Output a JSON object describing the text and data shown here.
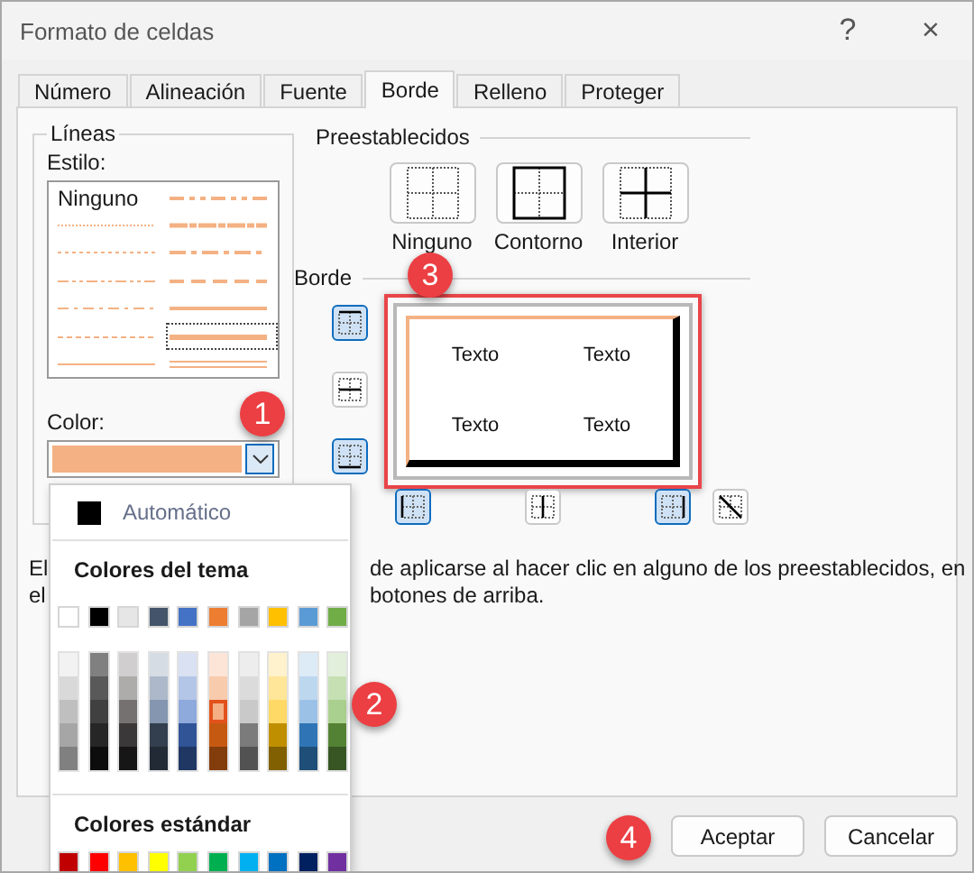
{
  "window": {
    "title": "Formato de celdas",
    "help": "?",
    "close": "×"
  },
  "tabs": [
    {
      "label": "Número",
      "selected": false
    },
    {
      "label": "Alineación",
      "selected": false
    },
    {
      "label": "Fuente",
      "selected": false
    },
    {
      "label": "Borde",
      "selected": true
    },
    {
      "label": "Relleno",
      "selected": false
    },
    {
      "label": "Proteger",
      "selected": false
    }
  ],
  "lines": {
    "title": "Líneas",
    "style_label": "Estilo:",
    "styles": [
      {
        "kind": "none",
        "label": "Ninguno",
        "selected": false
      },
      {
        "kind": "hair",
        "selected": false
      },
      {
        "kind": "dotted",
        "selected": false
      },
      {
        "kind": "dashdotdot",
        "selected": false
      },
      {
        "kind": "dashdot",
        "selected": false
      },
      {
        "kind": "dashed",
        "selected": false
      },
      {
        "kind": "thin",
        "selected": false
      },
      {
        "kind": "medium-dashdotdot",
        "selected": false
      },
      {
        "kind": "slanted-dashdot",
        "selected": false
      },
      {
        "kind": "medium-dashdot",
        "selected": false
      },
      {
        "kind": "medium-dashed",
        "selected": false
      },
      {
        "kind": "medium",
        "selected": false
      },
      {
        "kind": "thick",
        "selected": true
      },
      {
        "kind": "double",
        "selected": false
      }
    ],
    "color_label": "Color:",
    "color": "#f4b183"
  },
  "presets": {
    "title": "Preestablecidos",
    "items": [
      {
        "kind": "none",
        "label": "Ninguno"
      },
      {
        "kind": "outline",
        "label": "Contorno"
      },
      {
        "kind": "inside",
        "label": "Interior"
      }
    ]
  },
  "border": {
    "title": "Borde",
    "side_buttons": [
      {
        "kind": "top",
        "selected": true
      },
      {
        "kind": "middle-h",
        "selected": false
      },
      {
        "kind": "bottom",
        "selected": true
      }
    ],
    "bottom_buttons": [
      {
        "kind": "left",
        "selected": true
      },
      {
        "kind": "middle-v",
        "selected": false
      },
      {
        "kind": "right",
        "selected": true
      },
      {
        "kind": "diagonal",
        "selected": false
      }
    ],
    "preview": {
      "cells": [
        "Texto",
        "Texto",
        "Texto",
        "Texto"
      ],
      "borders": {
        "top": {
          "kind": "thin",
          "color": "#f4b183"
        },
        "left": {
          "kind": "thin",
          "color": "#f4b183"
        },
        "right": {
          "kind": "thick",
          "color": "#000000"
        },
        "bottom": {
          "kind": "thick",
          "color": "#000000"
        }
      }
    }
  },
  "description": [
    {
      "left": "El",
      "right": "de aplicarse al hacer clic en alguno de los preestablecidos, en"
    },
    {
      "left": "el",
      "right": "botones de arriba."
    }
  ],
  "color_menu": {
    "automatic": {
      "label": "Automático",
      "color": "#000000"
    },
    "theme_title": "Colores del tema",
    "theme_colors": [
      {
        "color": "#ffffff",
        "selected": false,
        "shades": [
          {
            "color": "#f2f2f2",
            "selected": false
          },
          {
            "color": "#d9d9d9",
            "selected": false
          },
          {
            "color": "#bfbfbf",
            "selected": false
          },
          {
            "color": "#a6a6a6",
            "selected": false
          },
          {
            "color": "#808080",
            "selected": false
          }
        ]
      },
      {
        "color": "#000000",
        "selected": false,
        "shades": [
          {
            "color": "#808080",
            "selected": false
          },
          {
            "color": "#595959",
            "selected": false
          },
          {
            "color": "#404040",
            "selected": false
          },
          {
            "color": "#262626",
            "selected": false
          },
          {
            "color": "#0d0d0d",
            "selected": false
          }
        ]
      },
      {
        "color": "#e7e6e6",
        "selected": false,
        "shades": [
          {
            "color": "#d0cece",
            "selected": false
          },
          {
            "color": "#aeabab",
            "selected": false
          },
          {
            "color": "#757171",
            "selected": false
          },
          {
            "color": "#3a3838",
            "selected": false
          },
          {
            "color": "#171616",
            "selected": false
          }
        ]
      },
      {
        "color": "#44546a",
        "selected": false,
        "shades": [
          {
            "color": "#d6dce4",
            "selected": false
          },
          {
            "color": "#adb9ca",
            "selected": false
          },
          {
            "color": "#8496b0",
            "selected": false
          },
          {
            "color": "#333f4f",
            "selected": false
          },
          {
            "color": "#222a35",
            "selected": false
          }
        ]
      },
      {
        "color": "#4472c4",
        "selected": false,
        "shades": [
          {
            "color": "#d9e1f2",
            "selected": false
          },
          {
            "color": "#b4c6e7",
            "selected": false
          },
          {
            "color": "#8ea9db",
            "selected": false
          },
          {
            "color": "#305496",
            "selected": false
          },
          {
            "color": "#203764",
            "selected": false
          }
        ]
      },
      {
        "color": "#ed7d31",
        "selected": false,
        "shades": [
          {
            "color": "#fce4d6",
            "selected": false
          },
          {
            "color": "#f8cbad",
            "selected": false
          },
          {
            "color": "#f4b084",
            "selected": true
          },
          {
            "color": "#c65911",
            "selected": false
          },
          {
            "color": "#833c0c",
            "selected": false
          }
        ]
      },
      {
        "color": "#a5a5a5",
        "selected": false,
        "shades": [
          {
            "color": "#ededed",
            "selected": false
          },
          {
            "color": "#dbdbdb",
            "selected": false
          },
          {
            "color": "#c9c9c9",
            "selected": false
          },
          {
            "color": "#7b7b7b",
            "selected": false
          },
          {
            "color": "#525252",
            "selected": false
          }
        ]
      },
      {
        "color": "#ffc000",
        "selected": false,
        "shades": [
          {
            "color": "#fff2cc",
            "selected": false
          },
          {
            "color": "#ffe699",
            "selected": false
          },
          {
            "color": "#ffd966",
            "selected": false
          },
          {
            "color": "#bf8f00",
            "selected": false
          },
          {
            "color": "#806000",
            "selected": false
          }
        ]
      },
      {
        "color": "#5b9bd5",
        "selected": false,
        "shades": [
          {
            "color": "#ddebf7",
            "selected": false
          },
          {
            "color": "#bdd7ee",
            "selected": false
          },
          {
            "color": "#9bc2e6",
            "selected": false
          },
          {
            "color": "#2f75b5",
            "selected": false
          },
          {
            "color": "#1f4e78",
            "selected": false
          }
        ]
      },
      {
        "color": "#70ad47",
        "selected": false,
        "shades": [
          {
            "color": "#e2efda",
            "selected": false
          },
          {
            "color": "#c6e0b4",
            "selected": false
          },
          {
            "color": "#a9d08e",
            "selected": false
          },
          {
            "color": "#548235",
            "selected": false
          },
          {
            "color": "#375623",
            "selected": false
          }
        ]
      }
    ],
    "standard_title": "Colores estándar",
    "standard_colors": [
      {
        "color": "#c00000",
        "selected": false
      },
      {
        "color": "#ff0000",
        "selected": false
      },
      {
        "color": "#ffc000",
        "selected": false
      },
      {
        "color": "#ffff00",
        "selected": false
      },
      {
        "color": "#92d050",
        "selected": false
      },
      {
        "color": "#00b050",
        "selected": false
      },
      {
        "color": "#00b0f0",
        "selected": false
      },
      {
        "color": "#0070c0",
        "selected": false
      },
      {
        "color": "#002060",
        "selected": false
      },
      {
        "color": "#7030a0",
        "selected": false
      }
    ]
  },
  "buttons": [
    "Aceptar",
    "Cancelar"
  ],
  "callouts": [
    "1",
    "2",
    "3",
    "4"
  ]
}
